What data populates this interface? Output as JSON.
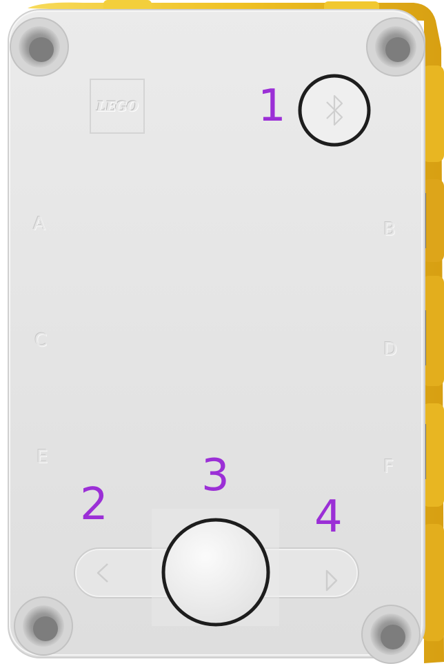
{
  "device": {
    "logo_text": "LEGO",
    "ports": {
      "a": "A",
      "b": "B",
      "c": "C",
      "d": "D",
      "e": "E",
      "f": "F"
    },
    "bluetooth_icon": "bluetooth-icon",
    "left_arrow_icon": "triangle-left-icon",
    "right_arrow_icon": "triangle-right-icon"
  },
  "callouts": {
    "one": "1",
    "two": "2",
    "three": "3",
    "four": "4"
  },
  "colors": {
    "callout": "#9b2fd6",
    "body": "#e3e3e3",
    "accent_yellow": "#f2c832",
    "ring": "#1d1d1d"
  }
}
